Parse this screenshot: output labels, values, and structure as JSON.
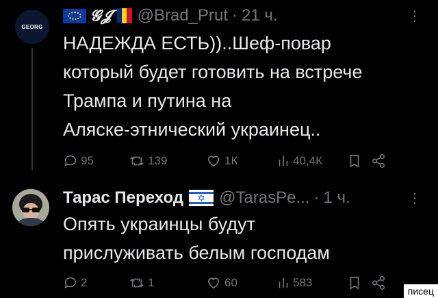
{
  "tweets": [
    {
      "avatar_text": "GEORG",
      "display_name": "𝓖𝓙",
      "handle": "@Brad_Prut",
      "dot": "·",
      "time": "21 ч.",
      "text": "НАДЕЖДА ЕСТЬ))..Шеф-повар\nкоторый будет готовить на встрече\nТрампа и путина на\nАляске-этнический украинец..",
      "metrics": {
        "replies": "95",
        "retweets": "139",
        "likes": "1К",
        "views": "40,4К"
      },
      "flags": [
        "eu-flag",
        "romania-flag"
      ]
    },
    {
      "display_name": "Тарас Переход",
      "handle": "@TarasPe...",
      "dot": "·",
      "time": "1 ч.",
      "text": "Опять украинцы будут\nприслуживать белым господам",
      "metrics": {
        "replies": "2",
        "retweets": "1",
        "likes": "60",
        "views": "583"
      },
      "flags": [
        "israel-flag"
      ]
    }
  ],
  "more_icon": "⋮",
  "watermark": "писец",
  "colors": {
    "background": "#000000",
    "text": "#e7e9ea",
    "muted": "#71767b"
  }
}
